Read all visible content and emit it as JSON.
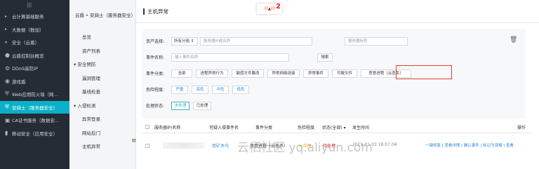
{
  "left_nav": {
    "top_icon": "|||",
    "items": [
      {
        "icon": "triangle-right-icon",
        "glyph": "▸",
        "label": "云计算基础服务"
      },
      {
        "icon": "triangle-right-icon",
        "glyph": "▸",
        "label": "大数据（数加）"
      },
      {
        "icon": "triangle-down-icon",
        "glyph": "▾",
        "label": "安全（云盾）"
      },
      {
        "icon": "dot-icon",
        "glyph": "●",
        "label": "云盾控制台概览"
      },
      {
        "icon": "gear-icon",
        "glyph": "⚙",
        "label": "DDoS高防IP"
      },
      {
        "icon": "globe-icon",
        "glyph": "◉",
        "label": "游戏盾"
      },
      {
        "icon": "shield-icon",
        "glyph": "⛨",
        "label": "Web应用防火墙（网..."
      },
      {
        "icon": "shield-check-icon",
        "glyph": "⛨",
        "label": "安骑士（服务器安全）"
      },
      {
        "icon": "certificate-icon",
        "glyph": "▣",
        "label": "CA证书服务（数据安..."
      },
      {
        "icon": "mobile-icon",
        "glyph": "▮",
        "label": "移动安全（应用安全）"
      }
    ]
  },
  "second_nav": {
    "header": "云盾 • 安骑士（服务器安全）",
    "items": [
      {
        "type": "item",
        "label": "总览"
      },
      {
        "type": "item",
        "label": "资产列表"
      },
      {
        "type": "group",
        "label": "▾  安全预防"
      },
      {
        "type": "item",
        "label": "漏洞管理"
      },
      {
        "type": "item",
        "label": "基线检查"
      },
      {
        "type": "group",
        "label": "▾  入侵检测"
      },
      {
        "type": "item",
        "label": "异常登录"
      },
      {
        "type": "item",
        "label": "网站后门"
      },
      {
        "type": "item",
        "label": "主机异常"
      }
    ],
    "collapse_glyph": "≡"
  },
  "page": {
    "title": "主机异常",
    "alert_badge": "(!▲!)",
    "alert_count": "2"
  },
  "filter": {
    "asset_label": "资产选择:",
    "group_select": "所有分组 ↕",
    "ip_placeholder": "服务器IP或名称",
    "tag_placeholder": "服务器标签",
    "event_label": "事件名称:",
    "event_placeholder": "输入事件名称",
    "search_label": "搜索",
    "category_label": "事件分类:",
    "categories": [
      "全部",
      "进程异常行为",
      "敏感文件篡改",
      "异常网络连接",
      "异常事件",
      "可疑文件",
      "恶意进程（云查杀）"
    ],
    "danger_label": "危险程度:",
    "dangers": [
      "严重",
      "高危",
      "中危",
      "低危"
    ],
    "status_label": "处理状态:",
    "statuses": [
      "未处理",
      "已处理"
    ]
  },
  "table": {
    "headers": [
      "服务器IP/名称",
      "可疑入侵事件名",
      "事件分类",
      "危险程度",
      "状态(全部) ▾",
      "发生时间",
      "操作"
    ],
    "rows": [
      {
        "ip": "",
        "event": "挖矿木马",
        "category": "恶意进程（云查杀）",
        "danger": "✦ 中危",
        "status": "待处理",
        "time": "2019-01-03 18:07:04",
        "actions": "一键修复 | 查看详情 | 确认事件 | 标记为误报 | 查看"
      }
    ]
  },
  "watermark": "云栖社区 yq.aliyun.com",
  "colors": {
    "accent": "#0ab0c8",
    "danger": "#e02020",
    "link": "#2a8ae0",
    "highlight": "#e0442c",
    "warn": "#f39c12"
  }
}
